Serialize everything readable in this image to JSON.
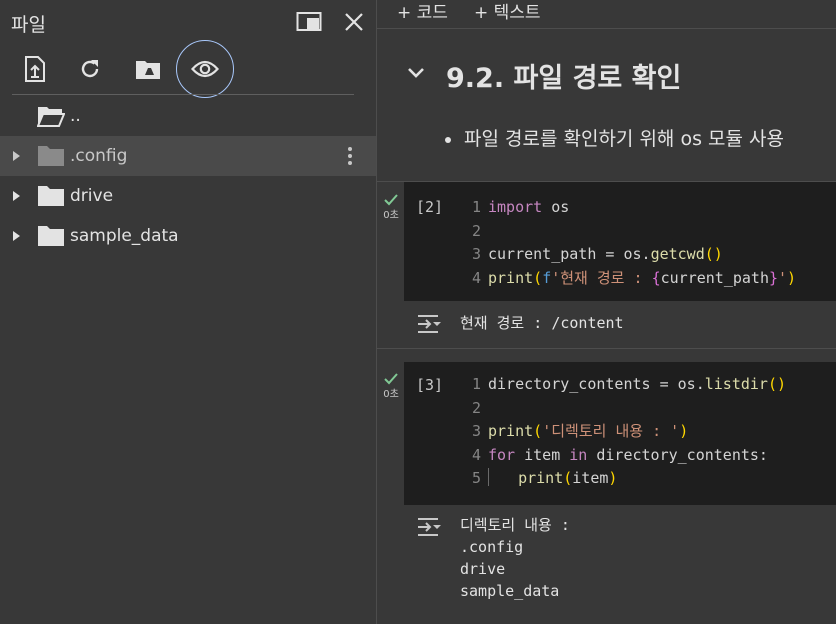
{
  "sidebar": {
    "title": "파일",
    "tree": [
      {
        "label": "..",
        "type": "parent"
      },
      {
        "label": ".config",
        "type": "folder",
        "selected": true
      },
      {
        "label": "drive",
        "type": "folder"
      },
      {
        "label": "sample_data",
        "type": "folder"
      }
    ],
    "icons": {
      "toolbar": [
        "upload-file-icon",
        "refresh-icon",
        "mount-drive-icon",
        "show-hidden-files-icon"
      ],
      "header": [
        "open-in-tab-icon",
        "close-icon"
      ]
    }
  },
  "notebook": {
    "add_code_label": "+ 코드",
    "add_text_label": "+ 텍스트",
    "section_title": "9.2. 파일 경로 확인",
    "bullet_text": "파일 경로를 확인하기 위해 os 모듈 사용",
    "cells": [
      {
        "exec_count": "[2]",
        "exec_time": "0초",
        "lines": [
          "import os",
          "",
          "current_path = os.getcwd()",
          "print(f'현재 경로 : {current_path}')"
        ],
        "output": [
          "현재 경로 : /content"
        ]
      },
      {
        "exec_count": "[3]",
        "exec_time": "0초",
        "lines": [
          "directory_contents = os.listdir()",
          "",
          "print('디렉토리 내용 : ')",
          "for item in directory_contents:",
          "    print(item)"
        ],
        "output": [
          "디렉토리 내용 :",
          ".config",
          "drive",
          "sample_data"
        ]
      }
    ]
  },
  "colors": {
    "background": "#383838",
    "cell_background": "#1e1e1e",
    "accent_focus": "#a8c7fa",
    "success_check": "#81c995",
    "keyword": "#c586c0",
    "function": "#dcdcaa",
    "string": "#ce9178"
  }
}
